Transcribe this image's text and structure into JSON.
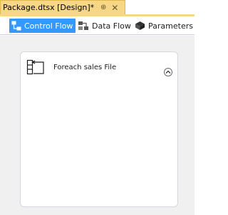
{
  "document_tab": {
    "title": "Package.dtsx [Design]*",
    "pin_glyph": "⊕",
    "close_glyph": "✕"
  },
  "designer_tabs": [
    {
      "label": "Control Flow",
      "icon": "control-flow-icon",
      "active": true
    },
    {
      "label": "Data Flow",
      "icon": "data-flow-icon",
      "active": false
    },
    {
      "label": "Parameters",
      "icon": "parameters-icon",
      "active": false
    }
  ],
  "canvas": {
    "container": {
      "label": "Foreach sales File",
      "icon": "foreach-loop-icon",
      "collapse_icon": "chevron-up-circle-icon"
    }
  },
  "colors": {
    "doc_tab_bg": "#f7d785",
    "active_tab_bg": "#3399ff",
    "canvas_bg": "#f0f0f0"
  }
}
